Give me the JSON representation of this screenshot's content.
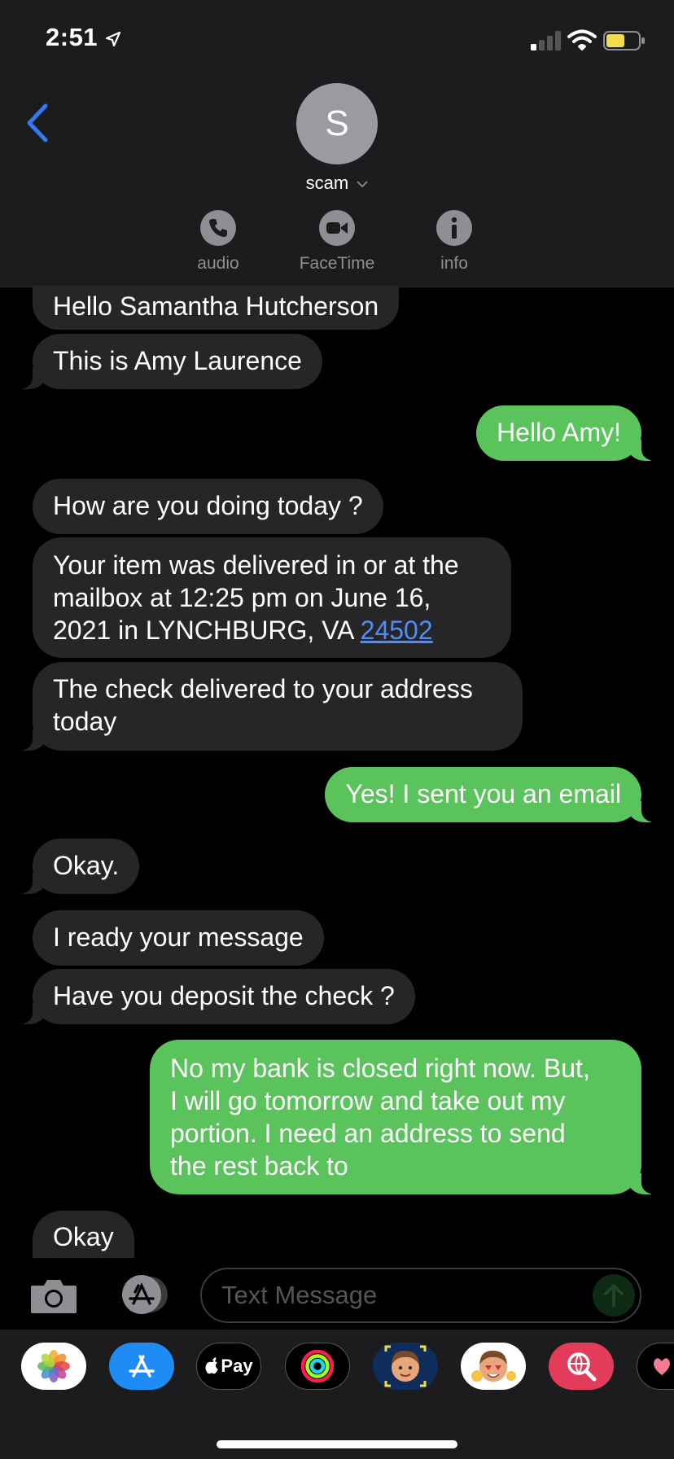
{
  "status_bar": {
    "time": "2:51"
  },
  "contact": {
    "initial": "S",
    "name": "scam"
  },
  "actions": [
    {
      "label": "audio",
      "icon": "phone-icon"
    },
    {
      "label": "FaceTime",
      "icon": "video-icon"
    },
    {
      "label": "info",
      "icon": "info-icon"
    }
  ],
  "messages": [
    {
      "from": "them",
      "text": "Hello Samantha Hutcherson"
    },
    {
      "from": "them",
      "text": "This is Amy Laurence"
    },
    {
      "from": "me",
      "text": "Hello Amy!"
    },
    {
      "from": "them",
      "text": "How are you doing today ?"
    },
    {
      "from": "them",
      "text_line1": "Your item was delivered in or at the",
      "text_line2": "mailbox at 12:25 pm on June 16,",
      "text_line3": "2021 in LYNCHBURG, VA ",
      "link": "24502"
    },
    {
      "from": "them",
      "text_line1": "The check delivered to your address",
      "text_line2": "today"
    },
    {
      "from": "me",
      "text": "Yes! I sent you an email"
    },
    {
      "from": "them",
      "text": "Okay."
    },
    {
      "from": "them",
      "text": "I ready your message"
    },
    {
      "from": "them",
      "text": "Have you deposit the check ?"
    },
    {
      "from": "me",
      "text_line1": "No my bank is closed right now. But,",
      "text_line2": "I will go tomorrow and take out my",
      "text_line3": "portion. I need an address to send",
      "text_line4": "the rest back to"
    },
    {
      "from": "them",
      "text": "Okay"
    }
  ],
  "composer": {
    "placeholder": "Text Message"
  },
  "app_drawer": {
    "apple_pay_label": "Pay"
  },
  "colors": {
    "incoming": "#262628",
    "outgoing": "#5ac35c",
    "accent": "#3478f6"
  }
}
